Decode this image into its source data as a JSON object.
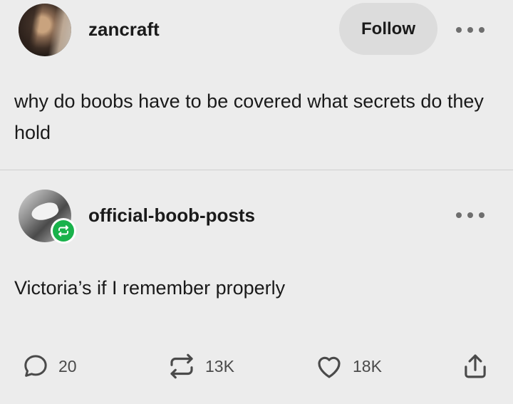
{
  "original_post": {
    "username": "zancraft",
    "follow_label": "Follow",
    "body": "why do boobs have to be covered what secrets do they hold"
  },
  "reblog": {
    "username": "official-boob-posts",
    "body": "Victoria’s if I remember properly"
  },
  "footer": {
    "notes_count": "20",
    "reblogs_count": "13K",
    "likes_count": "18K"
  },
  "icons": {
    "more": "more-options-icon",
    "comment": "comment-icon",
    "reblog": "reblog-icon",
    "like": "heart-icon",
    "share": "share-icon"
  },
  "colors": {
    "background": "#ececec",
    "reblog_badge": "#19b24b",
    "follow_button": "#dcdcdc"
  }
}
